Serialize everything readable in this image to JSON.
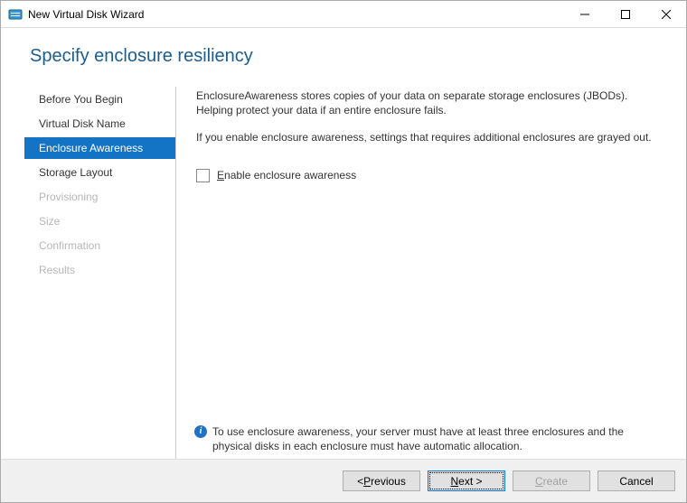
{
  "window": {
    "title": "New Virtual Disk Wizard"
  },
  "header": {
    "title": "Specify enclosure resiliency"
  },
  "sidebar": {
    "items": [
      {
        "label": "Before You Begin",
        "state": "normal"
      },
      {
        "label": "Virtual Disk Name",
        "state": "normal"
      },
      {
        "label": "Enclosure Awareness",
        "state": "selected"
      },
      {
        "label": "Storage Layout",
        "state": "normal"
      },
      {
        "label": "Provisioning",
        "state": "disabled"
      },
      {
        "label": "Size",
        "state": "disabled"
      },
      {
        "label": "Confirmation",
        "state": "disabled"
      },
      {
        "label": "Results",
        "state": "disabled"
      }
    ]
  },
  "content": {
    "desc1": "EnclosureAwareness stores copies of your data on separate storage enclosures (JBODs). Helping protect your data if an entire enclosure fails.",
    "desc2": "If you enable enclosure awareness, settings that requires additional enclosures are grayed out.",
    "checkbox": {
      "checked": false,
      "label_prefix": "E",
      "label_rest": "nable enclosure awareness"
    },
    "note": "To use enclosure awareness, your server must have at least three enclosures and the physical disks in each enclosure must have automatic allocation."
  },
  "buttons": {
    "previous": {
      "prefix": "< ",
      "ul": "P",
      "rest": "revious"
    },
    "next": {
      "ul": "N",
      "rest": "ext >"
    },
    "create": {
      "ul": "C",
      "rest": "reate"
    },
    "cancel": {
      "label": "Cancel"
    }
  }
}
